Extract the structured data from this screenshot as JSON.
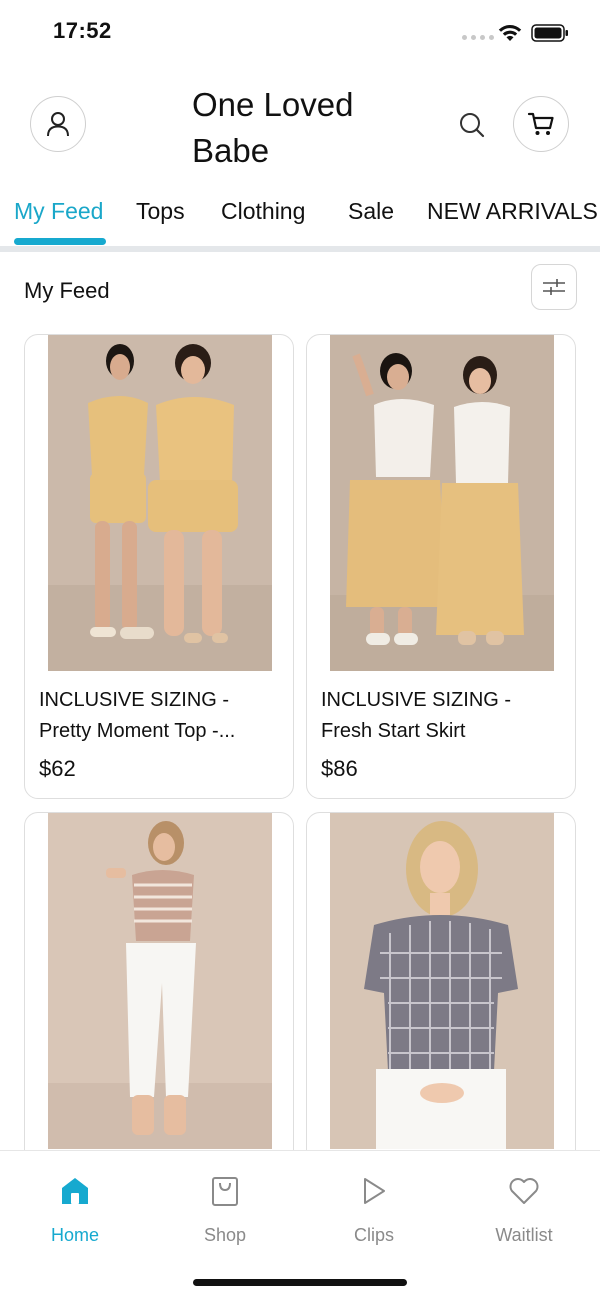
{
  "status_bar": {
    "time": "17:52"
  },
  "header": {
    "store_title": "One Loved Babe"
  },
  "tabs": [
    {
      "label": "My Feed",
      "active": true
    },
    {
      "label": "Tops",
      "active": false
    },
    {
      "label": "Clothing",
      "active": false
    },
    {
      "label": "Sale",
      "active": false
    },
    {
      "label": "NEW ARRIVALS",
      "active": false
    }
  ],
  "feed": {
    "title": "My Feed",
    "products": [
      {
        "name": "INCLUSIVE SIZING - Pretty Moment Top -...",
        "price": "$62"
      },
      {
        "name": "INCLUSIVE SIZING - Fresh Start Skirt",
        "price": "$86"
      },
      {
        "name": "",
        "price": ""
      },
      {
        "name": "",
        "price": ""
      }
    ]
  },
  "bottom_nav": {
    "items": [
      {
        "label": "Home",
        "icon": "home-icon",
        "active": true
      },
      {
        "label": "Shop",
        "icon": "shopping-bag-icon",
        "active": false
      },
      {
        "label": "Clips",
        "icon": "play-icon",
        "active": false
      },
      {
        "label": "Waitlist",
        "icon": "heart-icon",
        "active": false
      }
    ]
  },
  "colors": {
    "accent": "#16a9cf",
    "tab_divider": "#e4e7ea",
    "nav_inactive": "#8a8a8a"
  }
}
